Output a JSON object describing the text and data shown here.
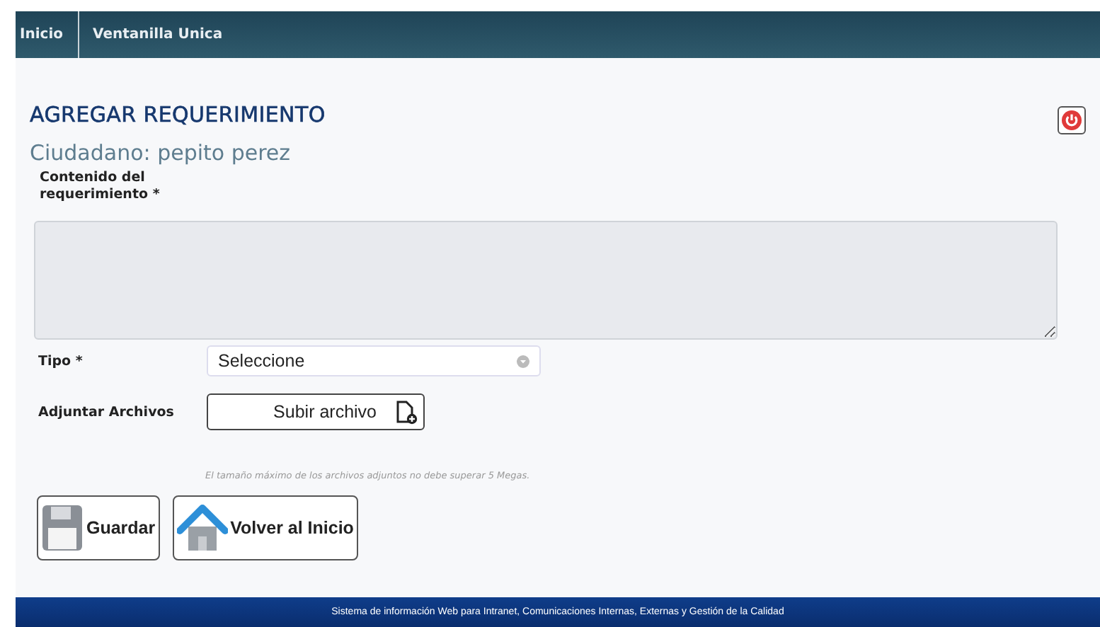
{
  "nav": {
    "items": [
      {
        "label": "Inicio"
      },
      {
        "label": "Ventanilla Unica"
      }
    ]
  },
  "title": "AGREGAR REQUERIMIENTO",
  "subtitle": "Ciudadano: pepito perez",
  "form": {
    "content_label": "Contenido del requerimiento *",
    "type_label": "Tipo *",
    "type_value": "Seleccione",
    "attach_label": "Adjuntar Archivos",
    "upload_button": "Subir archivo",
    "note": "El tamaño máximo de los archivos adjuntos no debe superar 5 Megas."
  },
  "buttons": [
    {
      "kind": "save",
      "label": "Guardar"
    },
    {
      "kind": "home",
      "label": "Volver al Inicio"
    }
  ],
  "footer": "Sistema de información Web para Intranet, Comunicaciones Internas, Externas y Gestión de la Calidad"
}
